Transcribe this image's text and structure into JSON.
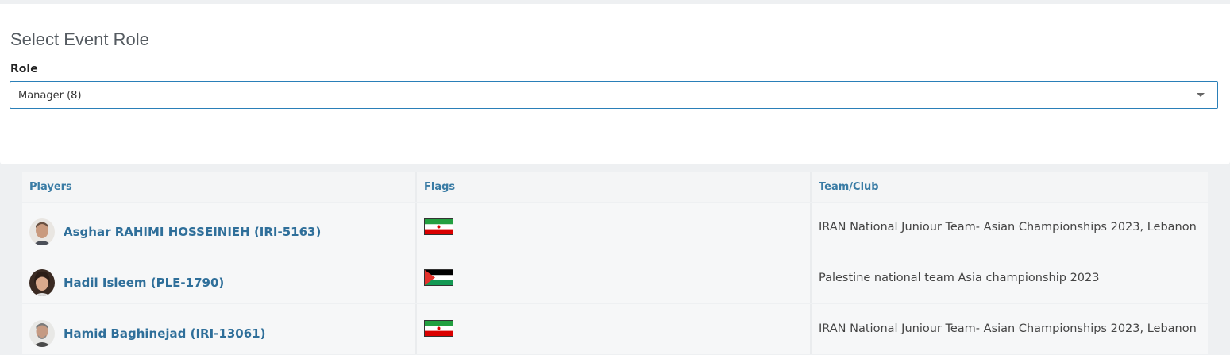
{
  "panel": {
    "title": "Select Event Role",
    "role_label": "Role",
    "role_value": "Manager (8)"
  },
  "table": {
    "headers": [
      "Players",
      "Flags",
      "Team/Club"
    ],
    "rows": [
      {
        "player": "Asghar RAHIMI HOSSEINIEH (IRI-5163)",
        "flag": "iran-flag",
        "team": "IRAN National Juniour Team- Asian Championships 2023, Lebanon"
      },
      {
        "player": "Hadil Isleem (PLE-1790)",
        "flag": "palestine-flag",
        "team": "Palestine national team Asia championship 2023"
      },
      {
        "player": "Hamid Baghinejad (IRI-13061)",
        "flag": "iran-flag",
        "team": "IRAN National Juniour Team- Asian Championships 2023, Lebanon"
      }
    ]
  },
  "colors": {
    "accent": "#2f6f9a",
    "header_text": "#3a7ca5",
    "select_border": "#2a7fb8"
  }
}
